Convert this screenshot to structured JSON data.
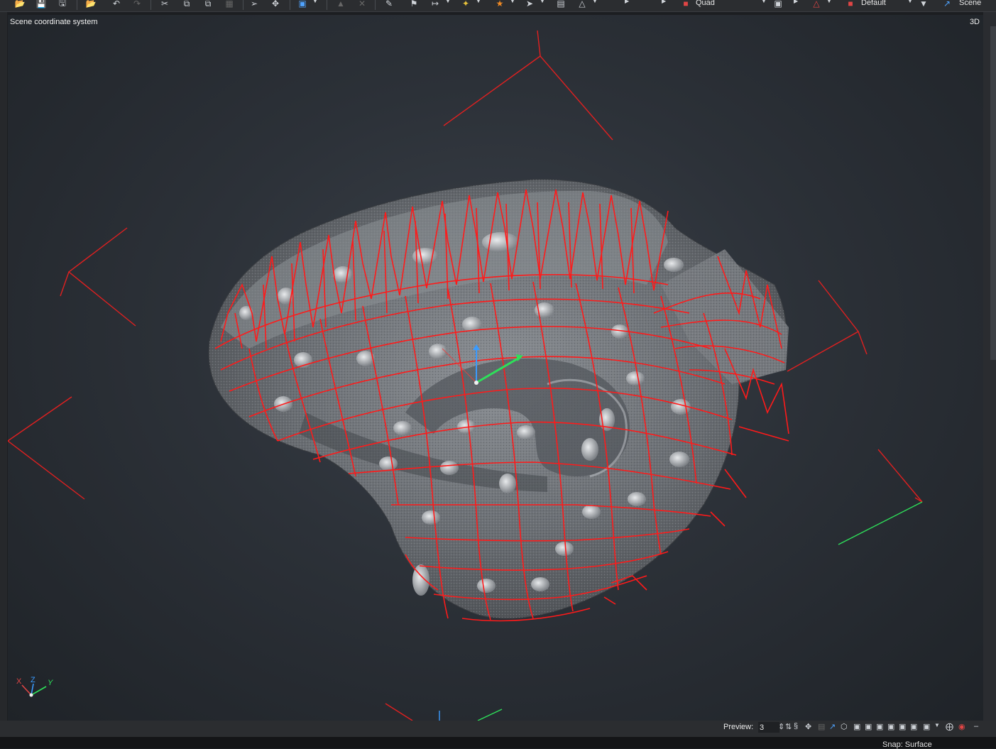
{
  "toolbar": {
    "render_mode_value": "Quad",
    "profile_value": "Default",
    "scene_label": "Scene"
  },
  "viewport": {
    "title": "Scene coordinate system",
    "mode_label": "3D",
    "axis_labels": {
      "x": "X",
      "z": "Z",
      "y": "Y"
    }
  },
  "status": {
    "preview_label": "Preview:",
    "preview_value": "3"
  },
  "bottom": {
    "snap_label": "Snap: Surface"
  },
  "colors": {
    "mesh_line": "#ff1a1a",
    "axis_x": "#e04545",
    "axis_y": "#34d45a",
    "axis_z": "#3a9bff",
    "background": "#2c3138"
  },
  "icons": [
    "open-icon",
    "save-icon",
    "save-all-icon",
    "undo-icon",
    "redo-icon",
    "cut-icon",
    "copy-icon",
    "paste-icon",
    "select-icon",
    "transform-icon",
    "measure-icon",
    "snap-icon",
    "filter-icon"
  ]
}
